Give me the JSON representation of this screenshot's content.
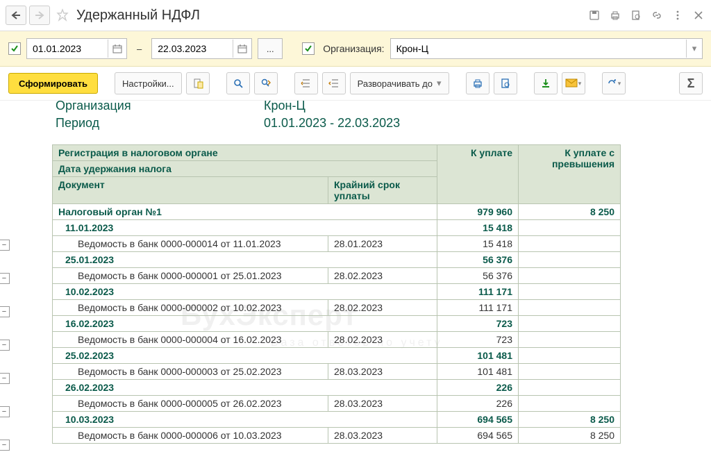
{
  "title": "Удержанный НДФЛ",
  "filter": {
    "date_from": "01.01.2023",
    "date_to": "22.03.2023",
    "org_label": "Организация:",
    "org_value": "Крон-Ц",
    "dash": "–",
    "ellipsis": "..."
  },
  "toolbar": {
    "generate": "Сформировать",
    "settings": "Настройки...",
    "expand": "Разворачивать до",
    "sigma": "Σ"
  },
  "report": {
    "org_label": "Организация",
    "org_value": "Крон-Ц",
    "period_label": "Период",
    "period_value": "01.01.2023 - 22.03.2023",
    "headers": {
      "reg": "Регистрация в налоговом органе",
      "date": "Дата удержания налога",
      "doc": "Документ",
      "deadline": "Крайний срок уплаты",
      "pay": "К уплате",
      "pay_exc": "К уплате с превышения"
    },
    "group": {
      "name": "Налоговый орган №1",
      "pay": "979 960",
      "pay_exc": "8 250"
    },
    "rows": [
      {
        "type": "date",
        "date": "11.01.2023",
        "pay": "15 418",
        "pay_exc": ""
      },
      {
        "type": "doc",
        "doc": "Ведомость в банк 0000-000014 от 11.01.2023",
        "deadline": "28.01.2023",
        "pay": "15 418",
        "pay_exc": ""
      },
      {
        "type": "date",
        "date": "25.01.2023",
        "pay": "56 376",
        "pay_exc": ""
      },
      {
        "type": "doc",
        "doc": "Ведомость в банк 0000-000001 от 25.01.2023",
        "deadline": "28.02.2023",
        "pay": "56 376",
        "pay_exc": ""
      },
      {
        "type": "date",
        "date": "10.02.2023",
        "pay": "111 171",
        "pay_exc": ""
      },
      {
        "type": "doc",
        "doc": "Ведомость в банк 0000-000002 от 10.02.2023",
        "deadline": "28.02.2023",
        "pay": "111 171",
        "pay_exc": ""
      },
      {
        "type": "date",
        "date": "16.02.2023",
        "pay": "723",
        "pay_exc": ""
      },
      {
        "type": "doc",
        "doc": "Ведомость в банк 0000-000004 от 16.02.2023",
        "deadline": "28.02.2023",
        "pay": "723",
        "pay_exc": ""
      },
      {
        "type": "date",
        "date": "25.02.2023",
        "pay": "101 481",
        "pay_exc": ""
      },
      {
        "type": "doc",
        "doc": "Ведомость в банк 0000-000003 от 25.02.2023",
        "deadline": "28.03.2023",
        "pay": "101 481",
        "pay_exc": ""
      },
      {
        "type": "date",
        "date": "26.02.2023",
        "pay": "226",
        "pay_exc": ""
      },
      {
        "type": "doc",
        "doc": "Ведомость в банк 0000-000005 от 26.02.2023",
        "deadline": "28.03.2023",
        "pay": "226",
        "pay_exc": ""
      },
      {
        "type": "date",
        "date": "10.03.2023",
        "pay": "694 565",
        "pay_exc": "8 250"
      },
      {
        "type": "doc",
        "doc": "Ведомость в банк 0000-000006 от 10.03.2023",
        "deadline": "28.03.2023",
        "pay": "694 565",
        "pay_exc": "8 250"
      }
    ]
  },
  "watermark": {
    "title": "БухЭксперт",
    "sub": "База ответов по учету"
  }
}
